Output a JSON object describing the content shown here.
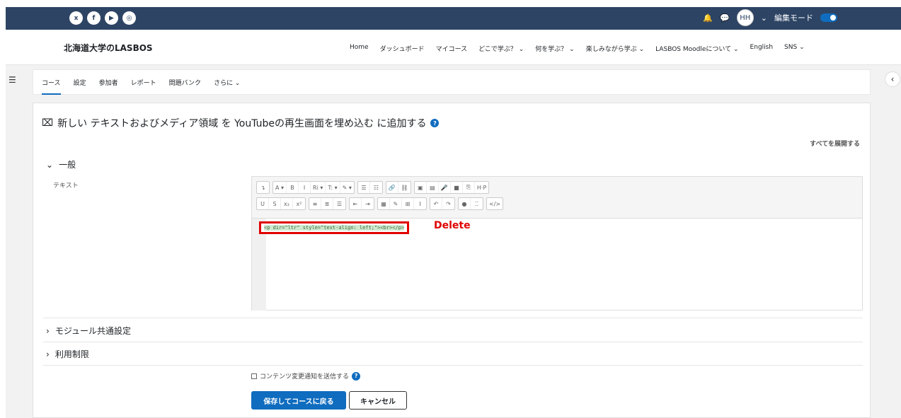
{
  "topbar": {
    "social": [
      {
        "icon": "x-icon",
        "glyph": "x"
      },
      {
        "icon": "facebook-icon",
        "glyph": "f"
      },
      {
        "icon": "youtube-icon",
        "glyph": "▶"
      },
      {
        "icon": "instagram-icon",
        "glyph": "◎"
      }
    ],
    "bell_glyph": "🔔",
    "chat_glyph": "💬",
    "avatar": "HH",
    "chevron": "⌄",
    "edit_mode_label": "編集モード"
  },
  "brand": "北海道大学のLASBOS",
  "nav": [
    "Home",
    "ダッシュボード",
    "マイコース",
    "どこで学ぶ？ ⌄",
    "何を学ぶ？ ⌄",
    "楽しみながら学ぶ ⌄",
    "LASBOS Moodleについて ⌄",
    "English",
    "SNS ⌄"
  ],
  "secondary_nav": [
    "コース",
    "設定",
    "参加者",
    "レポート",
    "問題バンク",
    "さらに ⌄"
  ],
  "heading": "新しい テキストおよびメディア領域 を YouTubeの再生画面を埋め込む に追加する",
  "expand_all": "すべてを展開する",
  "sections": {
    "general": "一般",
    "module_common": "モジュール共通設定",
    "restrictions": "利用制限"
  },
  "field_label": "テキスト",
  "toolbar": {
    "row1": [
      [
        "↴"
      ],
      [
        "A ▾",
        "B",
        "I",
        "Ri ▾",
        "T: ▾",
        "✎ ▾"
      ],
      [
        "☰",
        "☷"
      ],
      [
        "🔗",
        "⛓"
      ],
      [
        "▣",
        "▤",
        "🎤",
        "■",
        "⎘",
        "H·P"
      ]
    ],
    "row2": [
      [
        "U",
        "S",
        "x₂",
        "x²"
      ],
      [
        "≡",
        "≣",
        "☰"
      ],
      [
        "⇤",
        "⇥"
      ],
      [
        "▦",
        "✎",
        "⊞",
        "Ι"
      ],
      [
        "↶",
        "↷"
      ],
      [
        "●",
        "⁚⁚"
      ],
      [
        "</>"
      ]
    ]
  },
  "code_text": "<p dir=\"ltr\" style=\"text-align: left;\"><br></p>",
  "annotation": "Delete",
  "notify_label": "コンテンツ変更通知を送信する",
  "buttons": {
    "save": "保存してコースに戻る",
    "cancel": "キャンセル"
  },
  "colors": {
    "topbar": "#2d4464",
    "primary": "#0f6cbf",
    "annotation": "#e00000"
  }
}
